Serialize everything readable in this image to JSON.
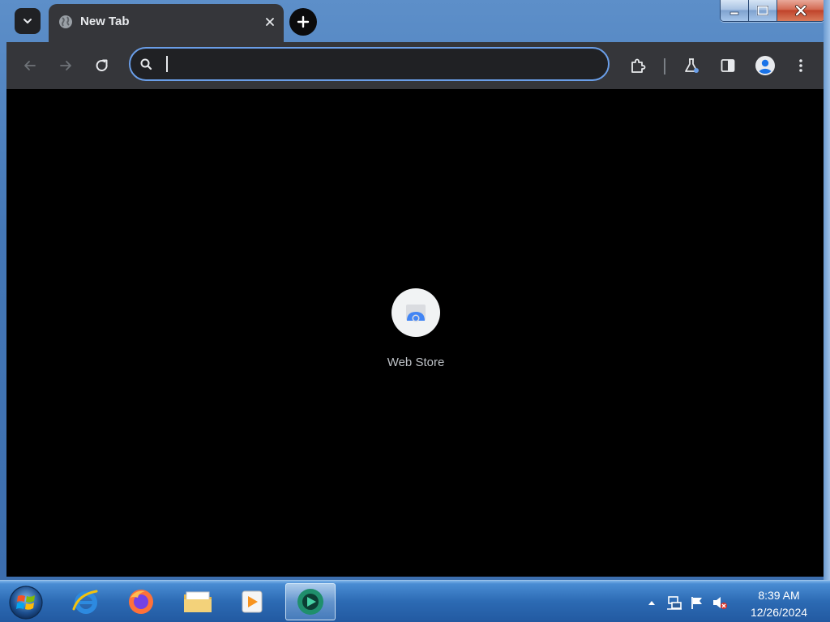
{
  "window": {
    "caption_buttons": [
      "minimize-icon",
      "maximize-icon",
      "close-icon"
    ]
  },
  "browser": {
    "tab": {
      "title": "New Tab",
      "favicon": "globe-icon"
    },
    "toolbar": {
      "omnibox": {
        "value": "",
        "placeholder": ""
      },
      "icons": [
        "back-arrow-icon",
        "forward-arrow-icon",
        "reload-icon",
        "search-icon",
        "extensions-puzzle-icon",
        "labs-flask-icon",
        "side-panel-icon",
        "profile-avatar-icon",
        "kebab-menu-icon"
      ]
    },
    "new_tab_page": {
      "shortcuts": [
        {
          "label": "Web Store",
          "icon": "web-store-icon"
        }
      ]
    },
    "colors": {
      "tab_bg": "#35363a",
      "page_bg": "#000000",
      "omnibox_border": "#6a9ee8"
    }
  },
  "taskbar": {
    "apps": [
      {
        "name": "Internet Explorer",
        "icon": "ie-icon",
        "active": false
      },
      {
        "name": "Firefox",
        "icon": "firefox-icon",
        "active": false
      },
      {
        "name": "Windows Explorer",
        "icon": "folder-icon",
        "active": false
      },
      {
        "name": "Media Player",
        "icon": "media-player-icon",
        "active": false
      },
      {
        "name": "Chrome",
        "icon": "chrome-app-icon",
        "active": true
      }
    ],
    "tray_icons": [
      "show-hidden-icons-arrow",
      "network-icon",
      "action-center-flag-icon",
      "volume-muted-icon"
    ],
    "clock": {
      "time": "8:39 AM",
      "date": "12/26/2024"
    }
  }
}
